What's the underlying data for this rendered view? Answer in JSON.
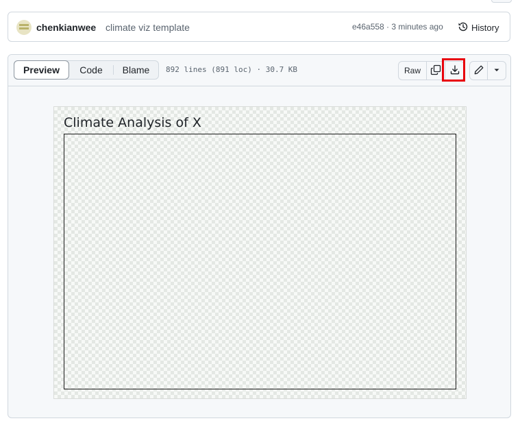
{
  "commit": {
    "author": "chenkianwee",
    "message": "climate viz template",
    "meta": "e46a558 · 3 minutes ago",
    "history_label": "History"
  },
  "file": {
    "tabs": [
      {
        "label": "Preview",
        "active": true
      },
      {
        "label": "Code",
        "active": false
      },
      {
        "label": "Blame",
        "active": false
      }
    ],
    "info": "892 lines (891 loc) · 30.7 KB",
    "raw_label": "Raw",
    "icons": [
      "copy-icon",
      "download-icon",
      "pencil-icon",
      "triangle-down-icon",
      "history-icon"
    ],
    "highlight_color": "#e8000b"
  },
  "preview": {
    "title": "Climate Analysis of X"
  }
}
